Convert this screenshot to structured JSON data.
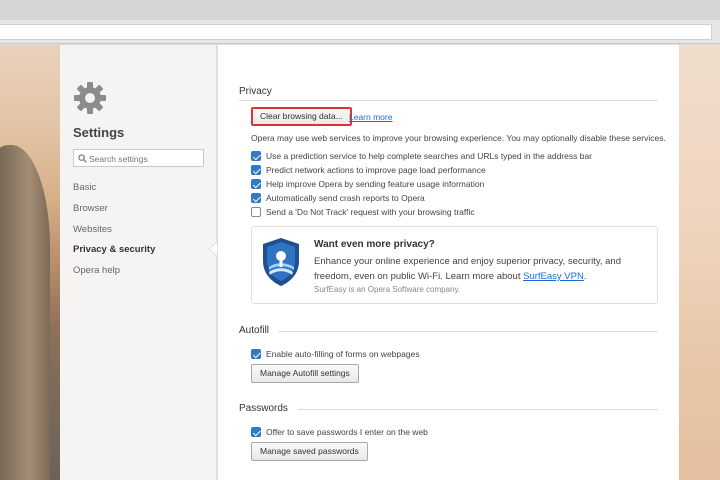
{
  "sidebar": {
    "title": "Settings",
    "search_placeholder": "Search settings",
    "items": [
      {
        "label": "Basic"
      },
      {
        "label": "Browser"
      },
      {
        "label": "Websites"
      },
      {
        "label": "Privacy & security"
      },
      {
        "label": "Opera help"
      }
    ],
    "active": "Privacy & security"
  },
  "privacy": {
    "title": "Privacy",
    "clear_button": "Clear browsing data...",
    "learn_more": "Learn more",
    "description": "Opera may use web services to improve your browsing experience. You may optionally disable these services.",
    "options": [
      {
        "label": "Use a prediction service to help complete searches and URLs typed in the address bar",
        "checked": true
      },
      {
        "label": "Predict network actions to improve page load performance",
        "checked": true
      },
      {
        "label": "Help improve Opera by sending feature usage information",
        "checked": true
      },
      {
        "label": "Automatically send crash reports to Opera",
        "checked": true
      },
      {
        "label": "Send a 'Do Not Track' request with your browsing traffic",
        "checked": false
      }
    ],
    "promo": {
      "title": "Want even more privacy?",
      "text_before": "Enhance your online experience and enjoy superior privacy, security, and freedom, even on public Wi-Fi. Learn more about ",
      "link": "SurfEasy VPN",
      "text_after": ".",
      "note": "SurfEasy is an Opera Software company."
    }
  },
  "autofill": {
    "title": "Autofill",
    "option": {
      "label": "Enable auto-filling of forms on webpages",
      "checked": true
    },
    "button": "Manage Autofill settings"
  },
  "passwords": {
    "title": "Passwords",
    "option": {
      "label": "Offer to save passwords I enter on the web",
      "checked": true
    },
    "button": "Manage saved passwords"
  },
  "colors": {
    "accent": "#2f7ac9",
    "link": "#1a6bd3",
    "focus_ring": "#dd3333"
  }
}
